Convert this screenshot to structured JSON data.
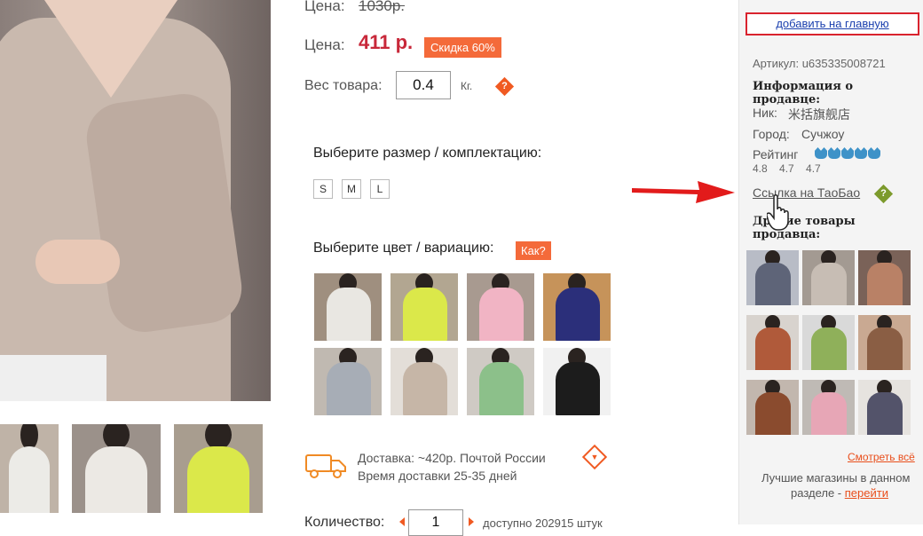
{
  "product": {
    "old_price_label": "Цена:",
    "old_price": "1030р.",
    "price_label": "Цена:",
    "price": "411 р.",
    "discount_badge": "Скидка 60%",
    "weight_label": "Вес товара:",
    "weight_value": "0.4",
    "weight_unit": "Кг.",
    "help_icon_label": "?"
  },
  "size": {
    "title": "Выберите размер / комплектацию:",
    "options": [
      "S",
      "M",
      "L"
    ]
  },
  "color": {
    "title": "Выберите цвет / вариацию:",
    "help_badge": "Как?",
    "variants": [
      {
        "name": "white",
        "color": "#e9e7e2",
        "bg": "#9f8f7f"
      },
      {
        "name": "lime",
        "color": "#dbe84a",
        "bg": "#b2a691"
      },
      {
        "name": "pink",
        "color": "#f1b4c4",
        "bg": "#a89a90"
      },
      {
        "name": "navy",
        "color": "#2b2f7a",
        "bg": "#c6935a"
      },
      {
        "name": "grey",
        "color": "#a7adb6",
        "bg": "#c0b9b1"
      },
      {
        "name": "beige",
        "color": "#c6b6a7",
        "bg": "#e3ded8"
      },
      {
        "name": "green",
        "color": "#8cc08a",
        "bg": "#cfcac4"
      },
      {
        "name": "black",
        "color": "#1c1c1c",
        "bg": "#f1f1f1"
      }
    ]
  },
  "delivery": {
    "line1": "Доставка: ~420р. Почтой России",
    "line2": "Время доставки 25-35 дней"
  },
  "quantity": {
    "label": "Количество:",
    "value": "1",
    "available": "доступно 202915 штук"
  },
  "sidebar": {
    "home_button": "добавить на главную",
    "article": "Артикул: u635335008721",
    "seller_title": "Информация о продавце:",
    "nick_label": "Ник:",
    "nick_value": "米括旗舰店",
    "city_label": "Город:",
    "city_value": "Сучжоу",
    "rating_label": "Рейтинг",
    "rating_crowns": 5,
    "scores": "4.8 4.7 4.7",
    "taobao_link": "Ссылка на ТаоБао",
    "other_goods": "Другие товары продавца:",
    "see_all": "Смотреть всё",
    "best_shops_line1": "Лучшие магазины в данном",
    "best_shops_line2": "разделе -",
    "best_shops_link": "перейти",
    "grid": [
      {
        "color": "#5e6478",
        "bg": "#b8bcc6"
      },
      {
        "color": "#c7bdb4",
        "bg": "#a39a92"
      },
      {
        "color": "#b98166",
        "bg": "#7a6258"
      },
      {
        "color": "#b05a3a",
        "bg": "#d8d3ce"
      },
      {
        "color": "#8fb05a",
        "bg": "#d9d9d9"
      },
      {
        "color": "#8a5e44",
        "bg": "#c9a992"
      },
      {
        "color": "#8a4b2e",
        "bg": "#c2b7ae"
      },
      {
        "color": "#e7a6b6",
        "bg": "#bfbab5"
      },
      {
        "color": "#53536a",
        "bg": "#e6e3df"
      }
    ]
  },
  "colors": {
    "accent": "#f46a3a",
    "price": "#c8283a",
    "link": "#1a3fae",
    "annotation_red": "#e21b1b"
  }
}
